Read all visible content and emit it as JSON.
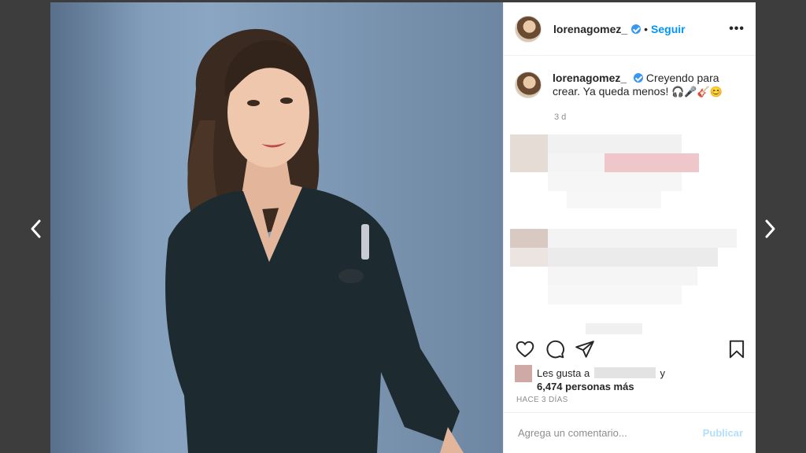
{
  "post": {
    "username": "lorenagomez_",
    "follow_separator": "•",
    "follow_label": "Seguir",
    "more_label": "•••",
    "caption_text": "Creyendo para crear. Ya queda menos!",
    "caption_emojis": "🎧🎤🎸😊",
    "time_ago": "3 d",
    "likes_prefix": "Les gusta a",
    "likes_suffix": "y",
    "likes_count_text": "6,474 personas más",
    "date_label": "HACE 3 DÍAS",
    "comment_placeholder": "Agrega un comentario...",
    "publish_label": "Publicar"
  },
  "icons": {
    "prev": "chevron-left-icon",
    "next": "chevron-right-icon",
    "like": "heart-icon",
    "comment": "comment-icon",
    "share": "paper-plane-icon",
    "save": "bookmark-icon",
    "verified": "verified-badge-icon"
  },
  "colors": {
    "background": "#3d3d3d",
    "accent": "#0095f6",
    "publish_disabled": "#b2dffc",
    "verified": "#3897f0"
  }
}
